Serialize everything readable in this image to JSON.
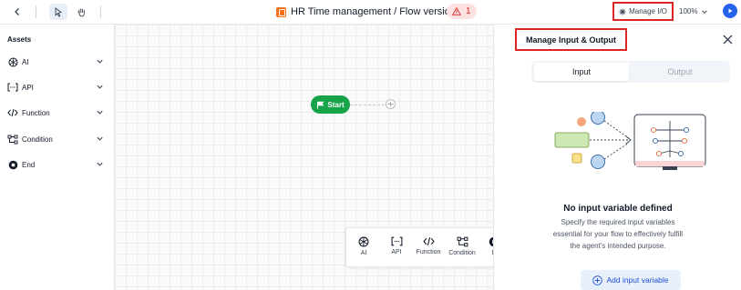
{
  "topbar": {
    "title": "HR Time management / Flow versions",
    "warning_count": "1",
    "manage_io_label": "Manage I/O",
    "zoom_label": "100%"
  },
  "sidebar": {
    "title": "Assets",
    "items": [
      {
        "label": "AI",
        "icon": "ai-icon"
      },
      {
        "label": "API",
        "icon": "api-icon"
      },
      {
        "label": "Function",
        "icon": "code-icon"
      },
      {
        "label": "Condition",
        "icon": "branch-icon"
      },
      {
        "label": "End",
        "icon": "stop-icon"
      }
    ]
  },
  "canvas": {
    "start_label": "Start",
    "tools": [
      {
        "label": "AI",
        "icon": "ai-icon"
      },
      {
        "label": "API",
        "icon": "api-icon"
      },
      {
        "label": "Function",
        "icon": "code-icon"
      },
      {
        "label": "Condition",
        "icon": "branch-icon"
      },
      {
        "label": "E",
        "icon": "stop-icon"
      }
    ]
  },
  "panel": {
    "title": "Manage Input & Output",
    "tabs": [
      "Input",
      "Output"
    ],
    "active_tab": "Input",
    "empty_title": "No input variable defined",
    "empty_description": "Specify the required input variables essential for your flow to effectively fulfill the agent's intended purpose.",
    "add_button_label": "Add input variable"
  },
  "colors": {
    "accent": "#2563eb",
    "start_node": "#16a34a",
    "highlight_border": "#dc2626",
    "warning": "#dc2626"
  }
}
